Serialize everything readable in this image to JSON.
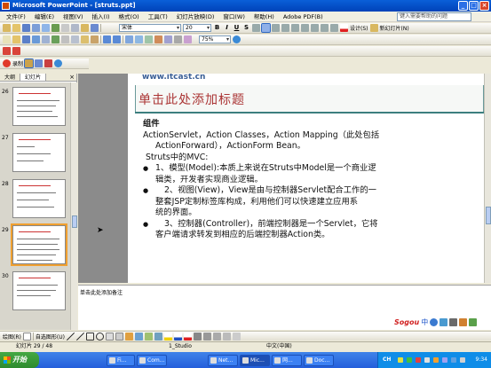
{
  "window": {
    "title": "Microsoft PowerPoint - [struts.ppt]",
    "minimize": "_",
    "restore": "□",
    "close": "×"
  },
  "menubar": {
    "items": [
      "文件(F)",
      "编辑(E)",
      "视图(V)",
      "插入(I)",
      "格式(O)",
      "工具(T)",
      "幻灯片放映(D)",
      "窗口(W)",
      "帮助(H)",
      "Adobe PDF(B)"
    ],
    "help_placeholder": "键入需要帮助的问题"
  },
  "format_toolbar": {
    "font": "宋体",
    "size": "20",
    "bold": "B",
    "italic": "I",
    "underline": "U",
    "shadow": "S",
    "design_label": "设计(S)",
    "new_slide_label": "新幻灯片(N)"
  },
  "standard_toolbar": {
    "zoom": "75%"
  },
  "record_toolbar": {
    "record_label": "录制"
  },
  "left_pane": {
    "tabs": [
      "大纲",
      "幻灯片"
    ],
    "close": "×",
    "slides": [
      {
        "number": "26",
        "selected": false
      },
      {
        "number": "27",
        "selected": false
      },
      {
        "number": "28",
        "selected": false
      },
      {
        "number": "29",
        "selected": true
      },
      {
        "number": "30",
        "selected": false
      }
    ]
  },
  "slide": {
    "url": "www.itcast.cn",
    "title": "单击此处添加标题",
    "heading": "组件",
    "lines": [
      "ActionServlet，Action Classes，Action Mapping（此处包括",
      "ActionForward），ActionForm Bean。",
      "Struts中的MVC:"
    ],
    "bullets": [
      [
        "1、模型(Model):本质上来说在Struts中Model是一个商业逻",
        "辑类，开发者实现商业逻辑。"
      ],
      [
        "2、视图(View)，View是由与控制器Servlet配合工作的一",
        "整套JSP定制标签库构成，利用他们可以快速建立应用系",
        "统的界面。"
      ],
      [
        "3、控制器(Controller)，前端控制器是一个Servlet，它将",
        "客户端请求转发到相应的后端控制器Action类。"
      ]
    ]
  },
  "notes": {
    "placeholder": "单击此处添加备注"
  },
  "ime": {
    "logo": "Sogou",
    "mode": "中"
  },
  "draw_toolbar": {
    "draw_label": "绘图(R)",
    "autoshapes_label": "自选图形(U)"
  },
  "statusbar": {
    "slide_info": "幻灯片 29 / 48",
    "design": "1_Studio",
    "language": "中文(中国)"
  },
  "taskbar": {
    "start_label": "开始",
    "tasks": [
      "Fi...",
      "Com...",
      "Net...",
      "Mic...",
      "网...",
      "Doc..."
    ],
    "active_task_index": 3,
    "ch": "CH",
    "clock": "9:34"
  }
}
